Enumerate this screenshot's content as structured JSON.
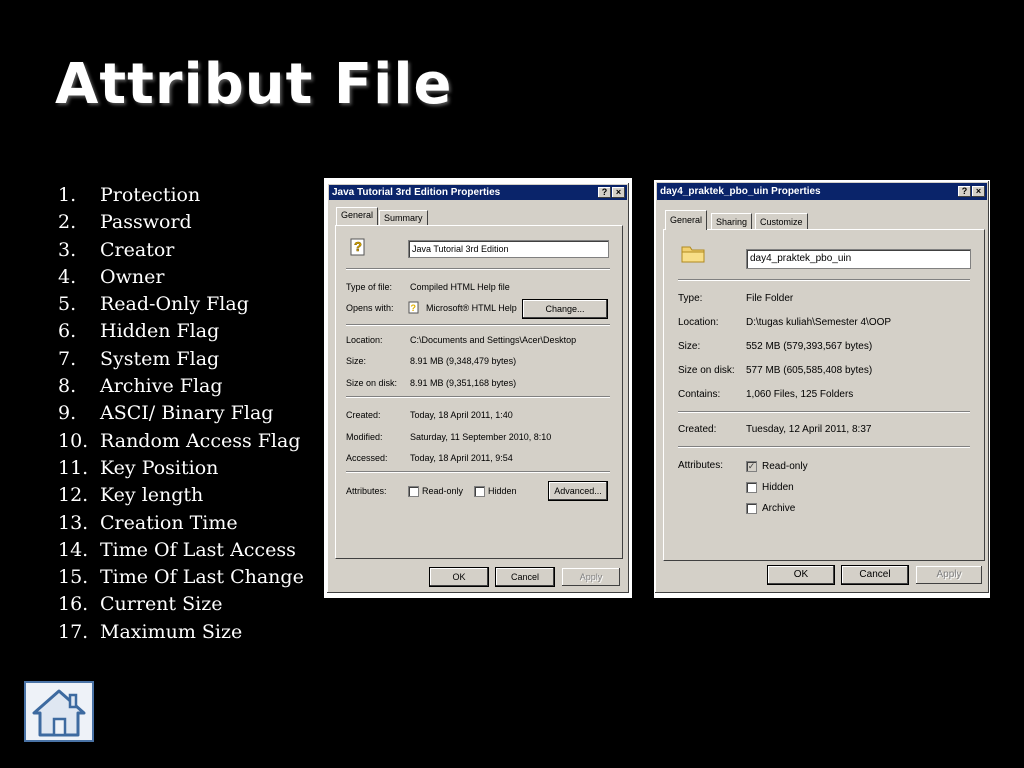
{
  "slide": {
    "title": "Attribut File",
    "list": [
      {
        "num": "1.",
        "text": "Protection"
      },
      {
        "num": "2.",
        "text": "Password"
      },
      {
        "num": "3.",
        "text": "Creator"
      },
      {
        "num": "4.",
        "text": "Owner"
      },
      {
        "num": "5.",
        "text": "Read-Only Flag"
      },
      {
        "num": "6.",
        "text": "Hidden Flag"
      },
      {
        "num": "7.",
        "text": "System Flag"
      },
      {
        "num": "8.",
        "text": "Archive Flag"
      },
      {
        "num": "9.",
        "text": "ASCI/ Binary Flag"
      },
      {
        "num": "10.",
        "text": "Random Access Flag"
      },
      {
        "num": "11.",
        "text": "Key Position"
      },
      {
        "num": "12.",
        "text": "Key length"
      },
      {
        "num": "13.",
        "text": "Creation Time"
      },
      {
        "num": "14.",
        "text": "Time Of Last Access"
      },
      {
        "num": "15.",
        "text": "Time Of Last Change"
      },
      {
        "num": "16.",
        "text": "Current Size"
      },
      {
        "num": "17.",
        "text": "Maximum Size"
      }
    ],
    "home_icon": "home-icon"
  },
  "dialog1": {
    "title": "Java Tutorial 3rd Edition Properties",
    "help_btn": "?",
    "close_btn": "×",
    "tabs": [
      "General",
      "Summary"
    ],
    "name": "Java Tutorial 3rd Edition",
    "type_label": "Type of file:",
    "type_value": "Compiled HTML Help file",
    "opens_label": "Opens with:",
    "opens_value": "Microsoft® HTML Help",
    "change_btn": "Change...",
    "location_label": "Location:",
    "location_value": "C:\\Documents and Settings\\Acer\\Desktop",
    "size_label": "Size:",
    "size_value": "8.91 MB (9,348,479 bytes)",
    "sizedisk_label": "Size on disk:",
    "sizedisk_value": "8.91 MB (9,351,168 bytes)",
    "created_label": "Created:",
    "created_value": "Today, 18 April 2011, 1:40",
    "modified_label": "Modified:",
    "modified_value": "Saturday, 11 September 2010, 8:10",
    "accessed_label": "Accessed:",
    "accessed_value": "Today, 18 April 2011, 9:54",
    "attributes_label": "Attributes:",
    "readonly_label": "Read-only",
    "readonly_checked": false,
    "hidden_label": "Hidden",
    "hidden_checked": false,
    "advanced_btn": "Advanced...",
    "ok_btn": "OK",
    "cancel_btn": "Cancel",
    "apply_btn": "Apply"
  },
  "dialog2": {
    "title": "day4_praktek_pbo_uin Properties",
    "help_btn": "?",
    "close_btn": "×",
    "tabs": [
      "General",
      "Sharing",
      "Customize"
    ],
    "name": "day4_praktek_pbo_uin",
    "type_label": "Type:",
    "type_value": "File Folder",
    "location_label": "Location:",
    "location_value": "D:\\tugas kuliah\\Semester 4\\OOP",
    "size_label": "Size:",
    "size_value": "552 MB (579,393,567 bytes)",
    "sizedisk_label": "Size on disk:",
    "sizedisk_value": "577 MB (605,585,408 bytes)",
    "contains_label": "Contains:",
    "contains_value": "1,060 Files, 125 Folders",
    "created_label": "Created:",
    "created_value": "Tuesday, 12 April 2011, 8:37",
    "attributes_label": "Attributes:",
    "readonly_label": "Read-only",
    "readonly_checked": true,
    "hidden_label": "Hidden",
    "hidden_checked": false,
    "archive_label": "Archive",
    "archive_checked": false,
    "ok_btn": "OK",
    "cancel_btn": "Cancel",
    "apply_btn": "Apply"
  }
}
